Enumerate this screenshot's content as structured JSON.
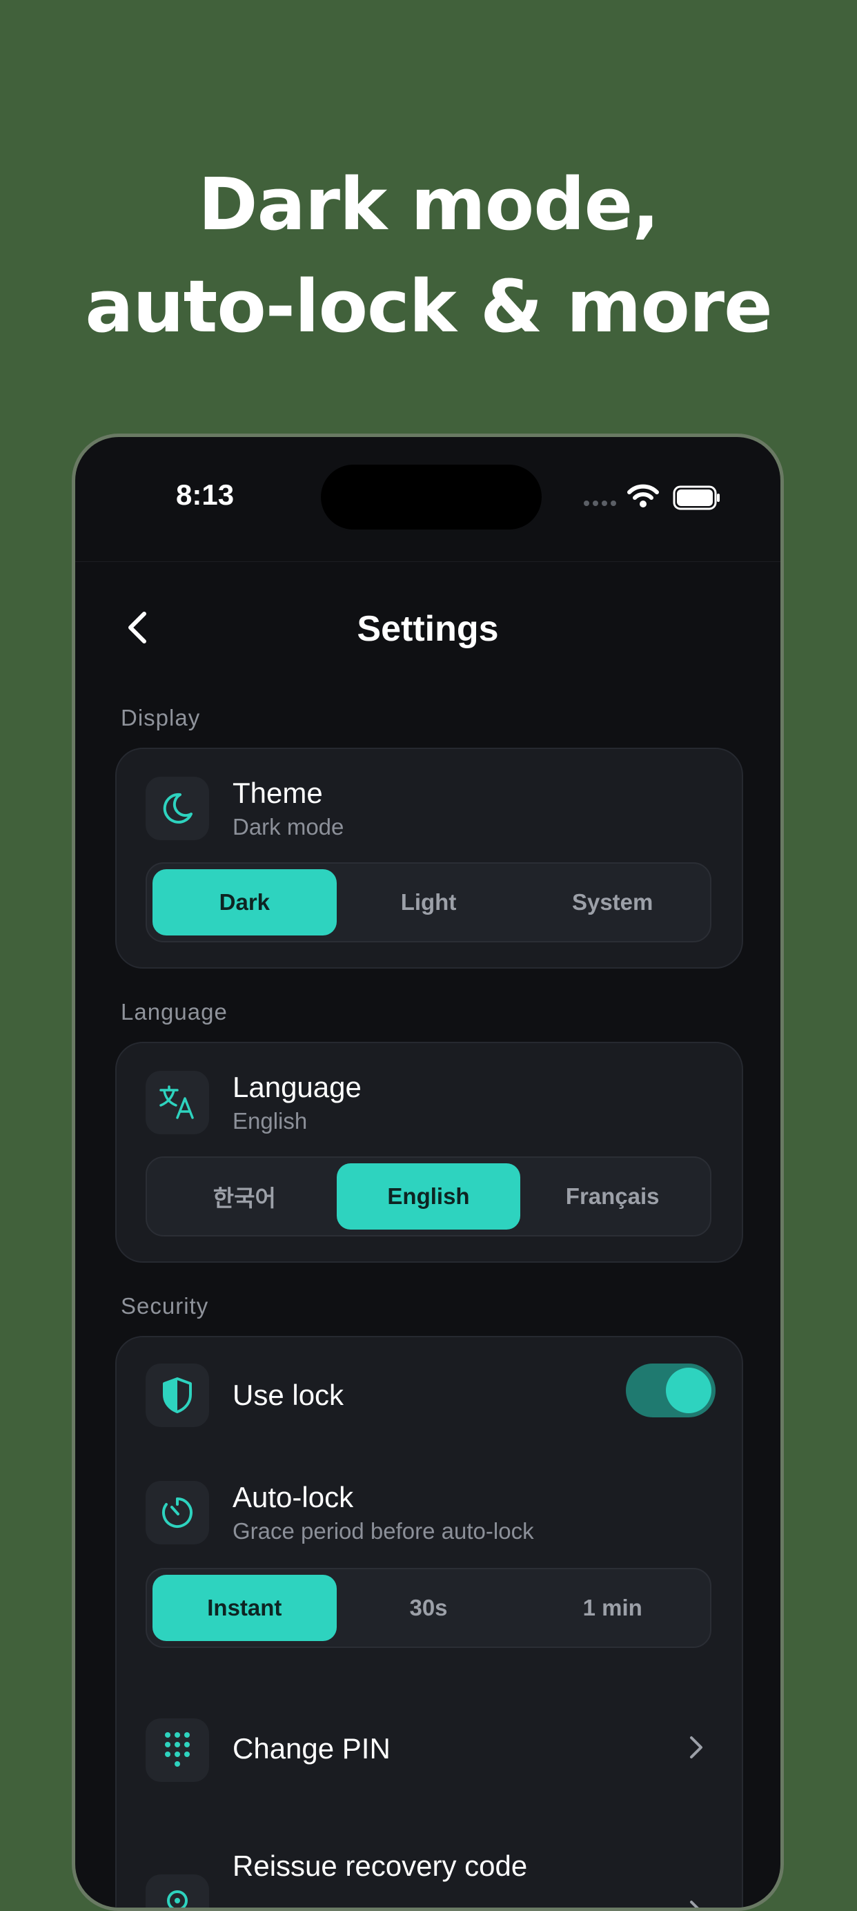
{
  "headline": {
    "line1": "Dark mode,",
    "line2": "auto-lock & more"
  },
  "status_bar": {
    "time": "8:13"
  },
  "nav": {
    "title": "Settings"
  },
  "colors": {
    "background": "#41613b",
    "accent": "#2ed3bf",
    "card": "#1a1c21"
  },
  "display": {
    "section_label": "Display",
    "title": "Theme",
    "subtitle": "Dark mode",
    "icon": "moon-icon",
    "options": [
      "Dark",
      "Light",
      "System"
    ],
    "selected": "Dark"
  },
  "language": {
    "section_label": "Language",
    "title": "Language",
    "subtitle": "English",
    "icon": "translate-icon",
    "options": [
      "한국어",
      "English",
      "Français"
    ],
    "selected": "English"
  },
  "security": {
    "section_label": "Security",
    "use_lock": {
      "title": "Use lock",
      "icon": "shield-icon",
      "enabled": true
    },
    "auto_lock": {
      "title": "Auto-lock",
      "subtitle": "Grace period before auto-lock",
      "icon": "timer-icon",
      "options": [
        "Instant",
        "30s",
        "1 min"
      ],
      "selected": "Instant"
    },
    "change_pin": {
      "title": "Change PIN",
      "icon": "keypad-icon"
    },
    "recovery": {
      "title": "Reissue recovery code",
      "icon": "key-icon"
    }
  }
}
